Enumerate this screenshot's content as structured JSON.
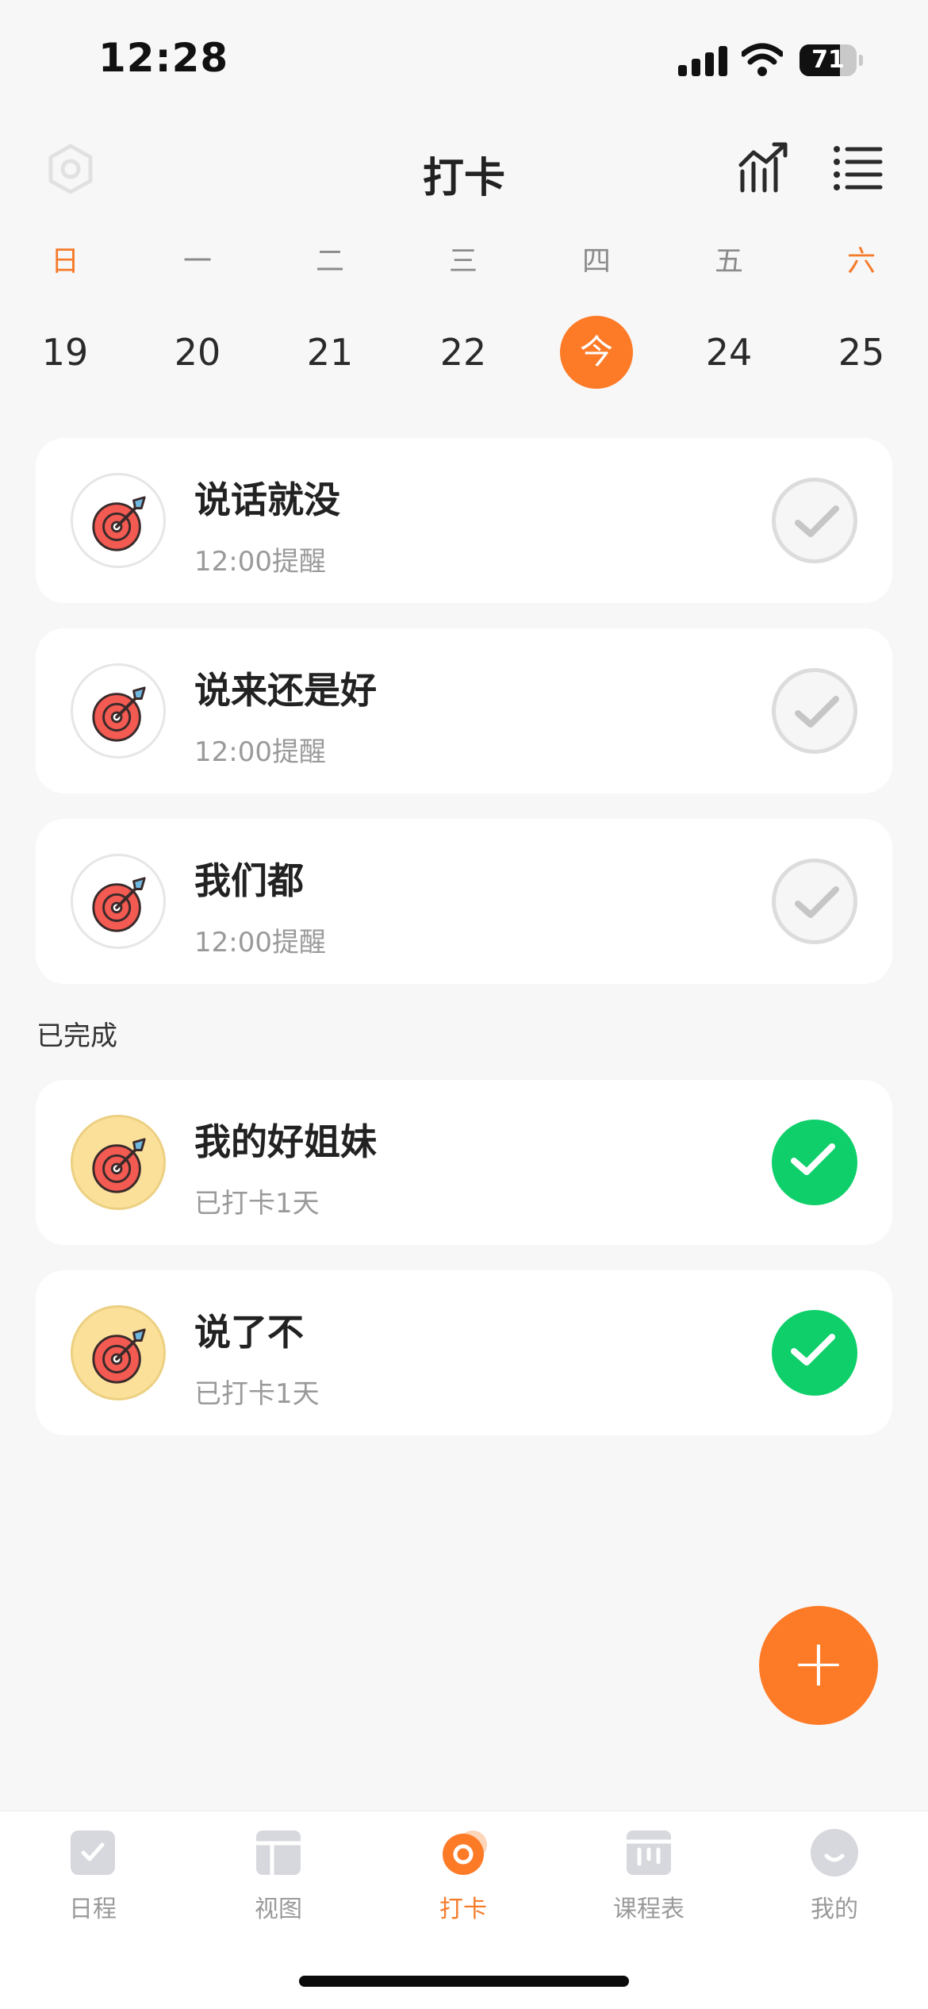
{
  "status_bar": {
    "time": "12:28",
    "battery": "71",
    "battery_level": 0.71
  },
  "header": {
    "title": "打卡",
    "left_icon": "settings-icon",
    "right_icons": [
      "stats-icon",
      "list-icon"
    ]
  },
  "week": {
    "labels": [
      "日",
      "一",
      "二",
      "三",
      "四",
      "五",
      "六"
    ],
    "dates": [
      "19",
      "20",
      "21",
      "22",
      "今",
      "24",
      "25"
    ],
    "selected_index": 4
  },
  "tasks": [
    {
      "title": "说话就没",
      "subtitle": "12:00提醒"
    },
    {
      "title": "说来还是好",
      "subtitle": "12:00提醒"
    },
    {
      "title": "我们都",
      "subtitle": "12:00提醒"
    }
  ],
  "completed": {
    "label": "已完成",
    "items": [
      {
        "title": "我的好姐妹",
        "subtitle": "已打卡1天"
      },
      {
        "title": "说了不",
        "subtitle": "已打卡1天"
      }
    ]
  },
  "fab": {
    "label": "+"
  },
  "tabs": [
    {
      "label": "日程",
      "icon": "schedule-icon"
    },
    {
      "label": "视图",
      "icon": "view-icon"
    },
    {
      "label": "打卡",
      "icon": "checkin-icon"
    },
    {
      "label": "课程表",
      "icon": "timetable-icon"
    },
    {
      "label": "我的",
      "icon": "profile-icon"
    }
  ],
  "colors": {
    "accent": "#fd7a27",
    "success": "#0ecf6a",
    "background": "#f7f7f7"
  }
}
